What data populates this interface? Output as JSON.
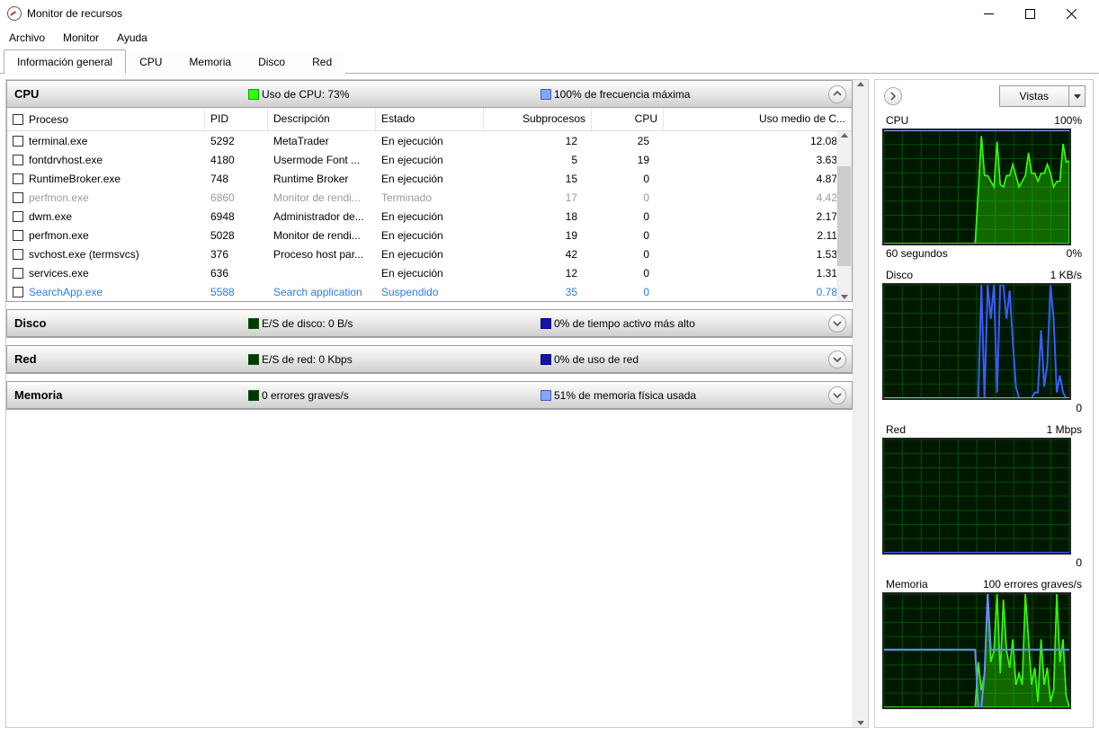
{
  "window": {
    "title": "Monitor de recursos"
  },
  "menu": {
    "archivo": "Archivo",
    "monitor": "Monitor",
    "ayuda": "Ayuda"
  },
  "tabs": {
    "overview": "Información general",
    "cpu": "CPU",
    "memory": "Memoria",
    "disk": "Disco",
    "network": "Red"
  },
  "sections": {
    "cpu": {
      "title": "CPU",
      "stat1": "Uso de CPU: 73%",
      "stat2": "100% de frecuencia máxima"
    },
    "disk": {
      "title": "Disco",
      "stat1": "E/S de disco: 0 B/s",
      "stat2": "0% de tiempo activo más alto"
    },
    "network": {
      "title": "Red",
      "stat1": "E/S de red: 0 Kbps",
      "stat2": "0% de uso de red"
    },
    "memory": {
      "title": "Memoria",
      "stat1": "0 errores graves/s",
      "stat2": "51% de memoria física usada"
    }
  },
  "columns": {
    "process": "Proceso",
    "pid": "PID",
    "desc": "Descripción",
    "status": "Estado",
    "threads": "Subprocesos",
    "cpu": "CPU",
    "avgcpu": "Uso medio de C..."
  },
  "processes": [
    {
      "name": "terminal.exe",
      "pid": "5292",
      "desc": "MetaTrader",
      "status": "En ejecución",
      "threads": "12",
      "cpu": "25",
      "avg": "12.08",
      "style": ""
    },
    {
      "name": "fontdrvhost.exe",
      "pid": "4180",
      "desc": "Usermode Font ...",
      "status": "En ejecución",
      "threads": "5",
      "cpu": "19",
      "avg": "3.63",
      "style": ""
    },
    {
      "name": "RuntimeBroker.exe",
      "pid": "748",
      "desc": "Runtime Broker",
      "status": "En ejecución",
      "threads": "15",
      "cpu": "0",
      "avg": "4.87",
      "style": ""
    },
    {
      "name": "perfmon.exe",
      "pid": "6860",
      "desc": "Monitor de rendi...",
      "status": "Terminado",
      "threads": "17",
      "cpu": "0",
      "avg": "4.42",
      "style": "dim"
    },
    {
      "name": "dwm.exe",
      "pid": "6948",
      "desc": "Administrador de...",
      "status": "En ejecución",
      "threads": "18",
      "cpu": "0",
      "avg": "2.17",
      "style": ""
    },
    {
      "name": "perfmon.exe",
      "pid": "5028",
      "desc": "Monitor de rendi...",
      "status": "En ejecución",
      "threads": "19",
      "cpu": "0",
      "avg": "2.11",
      "style": ""
    },
    {
      "name": "svchost.exe (termsvcs)",
      "pid": "376",
      "desc": "Proceso host par...",
      "status": "En ejecución",
      "threads": "42",
      "cpu": "0",
      "avg": "1.53",
      "style": ""
    },
    {
      "name": "services.exe",
      "pid": "636",
      "desc": "",
      "status": "En ejecución",
      "threads": "12",
      "cpu": "0",
      "avg": "1.31",
      "style": ""
    },
    {
      "name": "SearchApp.exe",
      "pid": "5588",
      "desc": "Search application",
      "status": "Suspendido",
      "threads": "35",
      "cpu": "0",
      "avg": "0.78",
      "style": "blue"
    }
  ],
  "right": {
    "vistas": "Vistas",
    "graphs": {
      "cpu": {
        "title": "CPU",
        "topRight": "100%",
        "botLeft": "60 segundos",
        "botRight": "0%"
      },
      "disk": {
        "title": "Disco",
        "topRight": "1 KB/s",
        "botRight": "0"
      },
      "net": {
        "title": "Red",
        "topRight": "1 Mbps",
        "botRight": "0"
      },
      "mem": {
        "title": "Memoria",
        "topRight": "100 errores graves/s"
      }
    }
  },
  "chart_data": [
    {
      "type": "area",
      "title": "CPU",
      "xlabel": "60 segundos",
      "ylabel": "%",
      "ylim": [
        0,
        100
      ],
      "series": [
        {
          "name": "Uso de CPU",
          "values": [
            0,
            0,
            0,
            0,
            0,
            0,
            0,
            0,
            0,
            0,
            0,
            0,
            0,
            0,
            0,
            0,
            0,
            0,
            0,
            0,
            0,
            0,
            0,
            0,
            0,
            0,
            0,
            0,
            0,
            0,
            45,
            95,
            60,
            60,
            55,
            50,
            90,
            52,
            50,
            60,
            60,
            70,
            60,
            50,
            55,
            60,
            80,
            62,
            62,
            55,
            62,
            62,
            70,
            62,
            50,
            55,
            55,
            88,
            72,
            73
          ]
        },
        {
          "name": "Frecuencia máxima",
          "values": [
            100,
            100,
            100,
            100,
            100,
            100,
            100,
            100,
            100,
            100,
            100,
            100,
            100,
            100,
            100,
            100,
            100,
            100,
            100,
            100,
            100,
            100,
            100,
            100,
            100,
            100,
            100,
            100,
            100,
            100,
            100,
            100,
            100,
            100,
            100,
            100,
            100,
            100,
            100,
            100,
            100,
            100,
            100,
            100,
            100,
            100,
            100,
            100,
            100,
            100,
            100,
            100,
            100,
            100,
            100,
            100,
            100,
            100,
            100,
            100
          ]
        }
      ]
    },
    {
      "type": "line",
      "title": "Disco",
      "ylabel": "KB/s",
      "ylim": [
        0,
        1
      ],
      "series": [
        {
          "name": "E/S de disco",
          "values": [
            0,
            0,
            0,
            0,
            0,
            0,
            0,
            0,
            0,
            0,
            0,
            0,
            0,
            0,
            0,
            0,
            0,
            0,
            0,
            0,
            0,
            0,
            0,
            0,
            0,
            0,
            0,
            0,
            0,
            0,
            0,
            1,
            0,
            1,
            0.7,
            1,
            0.05,
            1,
            1,
            0.7,
            0.95,
            0.5,
            0.1,
            0,
            0,
            0,
            0,
            0,
            0.05,
            0.05,
            0.6,
            0.1,
            0.3,
            1,
            0.7,
            0.05,
            0.2,
            0.05,
            0,
            0
          ]
        },
        {
          "name": "Tiempo activo",
          "values": [
            0,
            0,
            0,
            0,
            0,
            0,
            0,
            0,
            0,
            0,
            0,
            0,
            0,
            0,
            0,
            0,
            0,
            0,
            0,
            0,
            0,
            0,
            0,
            0,
            0,
            0,
            0,
            0,
            0,
            0,
            0,
            0,
            0,
            0,
            0,
            0,
            0,
            0,
            0,
            0,
            0,
            0,
            0,
            0,
            0,
            0,
            0,
            0,
            0,
            0,
            0,
            0,
            0,
            0,
            0,
            0,
            0,
            0,
            0,
            0
          ]
        }
      ]
    },
    {
      "type": "line",
      "title": "Red",
      "ylabel": "Mbps",
      "ylim": [
        0,
        1
      ],
      "series": [
        {
          "name": "E/S de red",
          "values": [
            0,
            0,
            0,
            0,
            0,
            0,
            0,
            0,
            0,
            0,
            0,
            0,
            0,
            0,
            0,
            0,
            0,
            0,
            0,
            0,
            0,
            0,
            0,
            0,
            0,
            0,
            0,
            0,
            0,
            0,
            0,
            0,
            0,
            0,
            0,
            0,
            0,
            0,
            0,
            0,
            0,
            0,
            0,
            0,
            0,
            0,
            0,
            0,
            0,
            0,
            0,
            0,
            0,
            0,
            0,
            0,
            0,
            0,
            0,
            0
          ]
        },
        {
          "name": "Uso de red",
          "values": [
            0,
            0,
            0,
            0,
            0,
            0,
            0,
            0,
            0,
            0,
            0,
            0,
            0,
            0,
            0,
            0,
            0,
            0,
            0,
            0,
            0,
            0,
            0,
            0,
            0,
            0,
            0,
            0,
            0,
            0,
            0,
            0,
            0,
            0,
            0,
            0,
            0,
            0,
            0,
            0,
            0,
            0,
            0,
            0,
            0,
            0,
            0,
            0,
            0,
            0,
            0,
            0,
            0,
            0,
            0,
            0,
            0,
            0,
            0,
            0
          ]
        }
      ]
    },
    {
      "type": "area",
      "title": "Memoria",
      "ylabel": "errores graves/s",
      "ylim": [
        0,
        100
      ],
      "series": [
        {
          "name": "Errores graves",
          "values": [
            0,
            0,
            0,
            0,
            0,
            0,
            0,
            0,
            0,
            0,
            0,
            0,
            0,
            0,
            0,
            0,
            0,
            0,
            0,
            0,
            0,
            0,
            0,
            0,
            0,
            0,
            0,
            0,
            0,
            0,
            40,
            15,
            30,
            100,
            40,
            50,
            100,
            30,
            95,
            50,
            35,
            60,
            20,
            30,
            20,
            100,
            60,
            20,
            35,
            5,
            60,
            20,
            35,
            5,
            15,
            100,
            40,
            60,
            10,
            0
          ]
        },
        {
          "name": "Memoria física usada",
          "values": [
            51,
            51,
            51,
            51,
            51,
            51,
            51,
            51,
            51,
            51,
            51,
            51,
            51,
            51,
            51,
            51,
            51,
            51,
            51,
            51,
            51,
            51,
            51,
            51,
            51,
            51,
            51,
            51,
            51,
            51,
            0,
            0,
            30,
            100,
            51,
            51,
            51,
            51,
            51,
            51,
            51,
            51,
            51,
            51,
            51,
            51,
            51,
            51,
            51,
            51,
            51,
            51,
            51,
            51,
            51,
            51,
            51,
            51,
            51,
            51
          ]
        }
      ]
    }
  ]
}
